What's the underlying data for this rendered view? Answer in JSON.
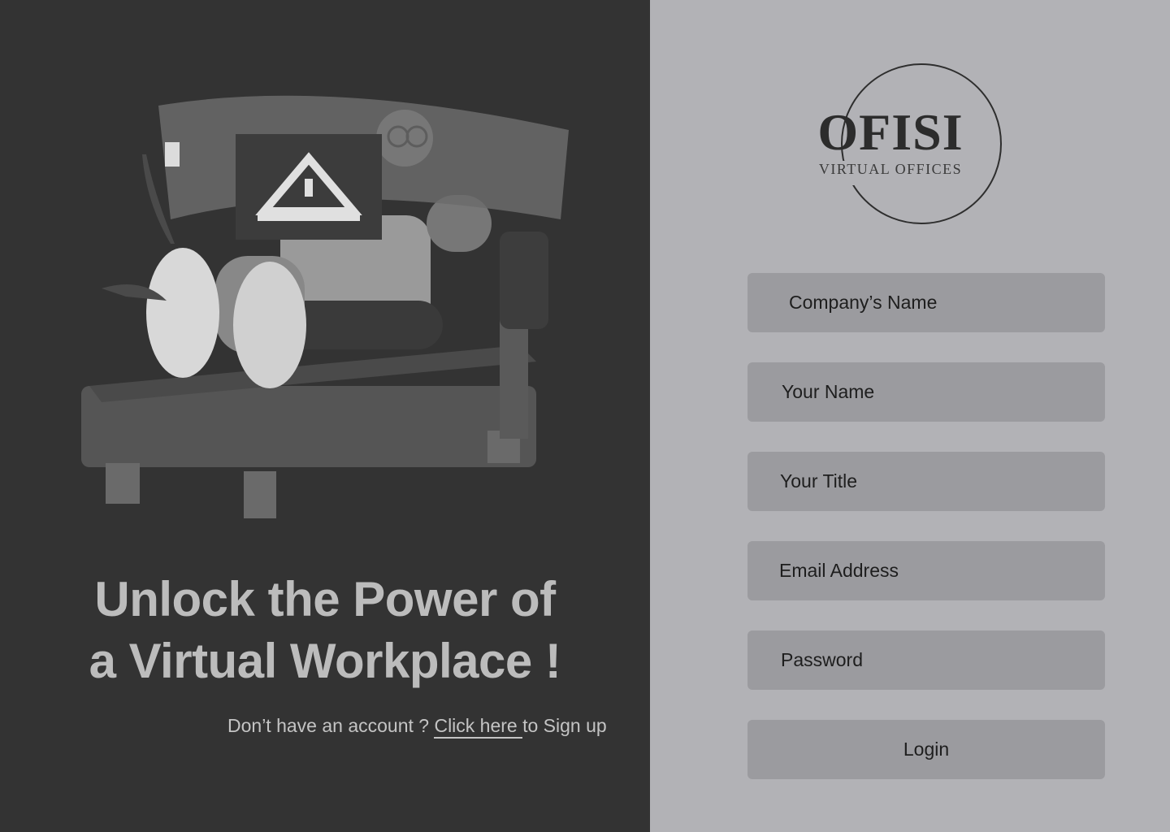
{
  "brand": {
    "name": "OFISI",
    "tagline": "VIRTUAL OFFICES"
  },
  "hero": {
    "headline_line1": "Unlock the Power of",
    "headline_line2": "a Virtual Workplace !",
    "signup_prefix": "Don’t have an account ? ",
    "signup_link": "Click here ",
    "signup_suffix": "to Sign up"
  },
  "form": {
    "company_placeholder": "Company’s Name",
    "name_placeholder": "Your Name",
    "title_placeholder": "Your Title",
    "email_placeholder": "Email Address",
    "password_placeholder": "Password",
    "login_label": "Login"
  },
  "colors": {
    "left_panel": "#333333",
    "right_panel": "#b2b2b6",
    "field_bg": "#9b9b9f",
    "headline": "#bcbcbc"
  }
}
